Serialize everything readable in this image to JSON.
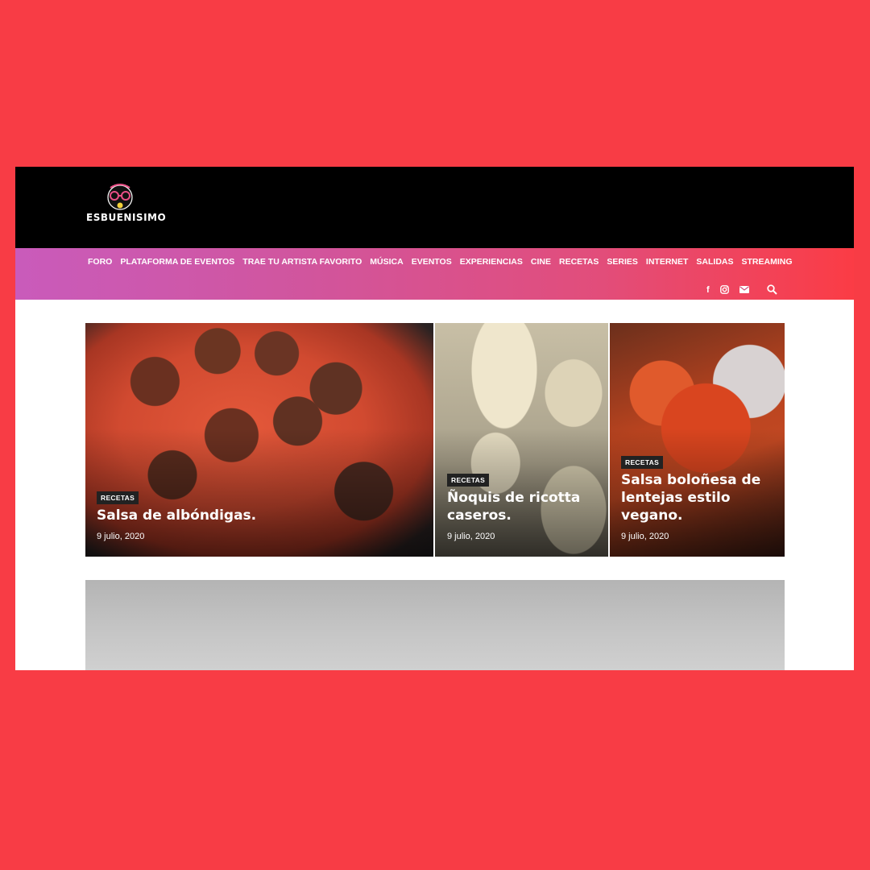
{
  "brand": {
    "logo_text": "ESBUENISIMO"
  },
  "nav": {
    "items": [
      "FORO",
      "PLATAFORMA DE EVENTOS",
      "TRAE TU ARTISTA FAVORITO",
      "MÚSICA",
      "EVENTOS",
      "EXPERIENCIAS",
      "CINE",
      "RECETAS",
      "SERIES",
      "INTERNET",
      "SALIDAS",
      "STREAMING"
    ]
  },
  "social": {
    "facebook_glyph": "f",
    "icons": [
      "facebook-icon",
      "instagram-icon",
      "mail-icon",
      "search-icon"
    ]
  },
  "featured": [
    {
      "category": "RECETAS",
      "title_lines": [
        "Salsa de albóndigas."
      ],
      "date": "9 julio, 2020"
    },
    {
      "category": "RECETAS",
      "title_lines": [
        "Ñoquis de ricotta",
        "caseros."
      ],
      "date": "9 julio, 2020"
    },
    {
      "category": "RECETAS",
      "title_lines": [
        "Salsa boloñesa de",
        "lentejas estilo",
        "vegano."
      ],
      "date": "9 julio, 2020"
    }
  ],
  "colors": {
    "page_background": "#f83c45",
    "header_background": "#000000",
    "nav_gradient_start": "#c95bbb",
    "nav_gradient_end": "#fb3c45",
    "badge_background": "#222222"
  }
}
